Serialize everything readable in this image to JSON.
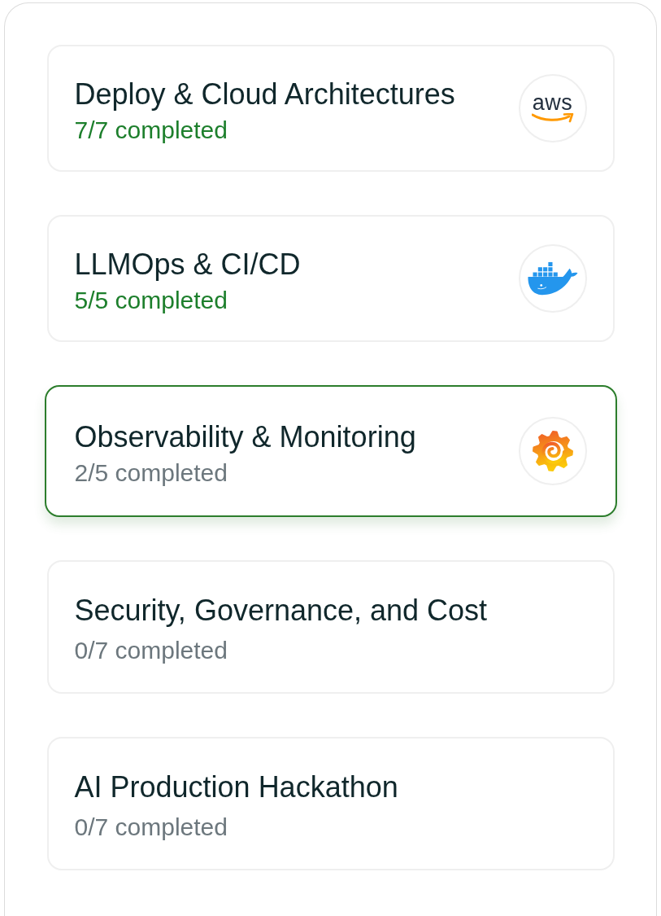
{
  "courses": [
    {
      "title": "Deploy & Cloud Architectures",
      "progress": "7/7 completed",
      "complete": true,
      "selected": false,
      "logo": {
        "kind": "wordmark",
        "text": "aws"
      }
    },
    {
      "title": "LLMOps & CI/CD",
      "progress": "5/5 completed",
      "complete": true,
      "selected": false,
      "logo": {
        "kind": "whale"
      }
    },
    {
      "title": "Observability & Monitoring",
      "progress": "2/5 completed",
      "complete": false,
      "selected": true,
      "logo": {
        "kind": "spiral-sun"
      }
    },
    {
      "title": "Security, Governance, and Cost",
      "progress": "0/7 completed",
      "complete": false,
      "selected": false
    },
    {
      "title": "AI Production Hackathon",
      "progress": "0/7 completed",
      "complete": false,
      "selected": false
    }
  ]
}
